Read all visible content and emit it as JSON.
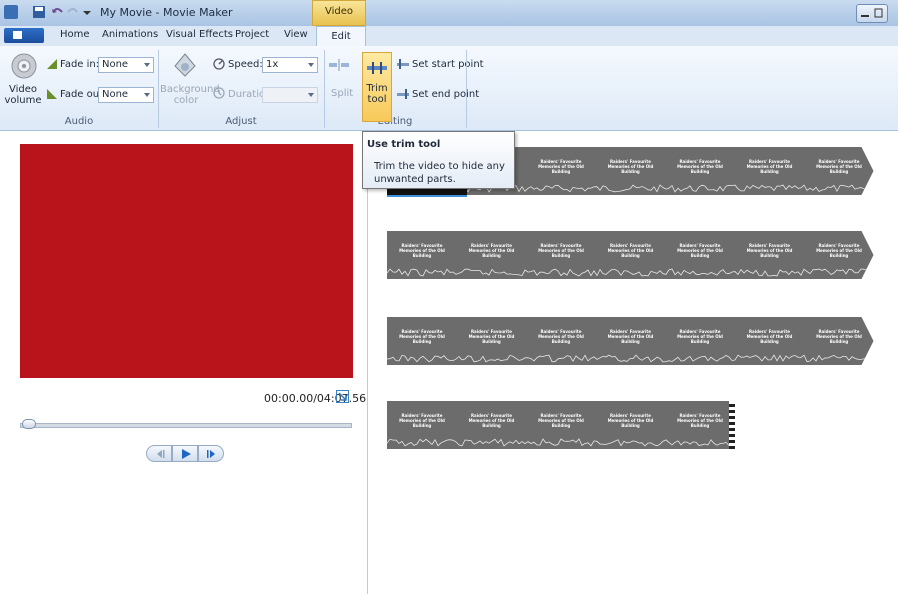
{
  "titlebar": {
    "title": "My Movie - Movie Maker",
    "contextual_tab_label": "Video Tools"
  },
  "tabs": [
    {
      "label": "Home"
    },
    {
      "label": "Animations"
    },
    {
      "label": "Visual Effects"
    },
    {
      "label": "Project"
    },
    {
      "label": "View"
    },
    {
      "label": "Edit",
      "selected": true
    }
  ],
  "ribbon": {
    "audio": {
      "group_label": "Audio",
      "video_volume_label": "Video volume",
      "fade_in_label": "Fade in:",
      "fade_in_value": "None",
      "fade_out_label": "Fade out:",
      "fade_out_value": "None"
    },
    "adjust": {
      "group_label": "Adjust",
      "background_color_label": "Background color",
      "speed_label": "Speed:",
      "speed_value": "1x",
      "duration_label": "Duration:",
      "duration_value": ""
    },
    "editing": {
      "group_label": "Editing",
      "split_label": "Split",
      "trim_tool_label": "Trim tool",
      "set_start_point_label": "Set start point",
      "set_end_point_label": "Set end point"
    }
  },
  "tooltip": {
    "title": "Use trim tool",
    "body": "Trim the video to hide any unwanted parts."
  },
  "preview": {
    "time_display": "00:00.00/04:07.56",
    "preview_color": "#b9141b"
  },
  "storyboard": {
    "frame_caption": "Raiders' Favourite Memories of the Old Building"
  },
  "colors": {
    "ribbon_bg": "#dde9f7",
    "trim_highlight": "#f8c95a",
    "strip_gray": "#6c6c6c"
  }
}
